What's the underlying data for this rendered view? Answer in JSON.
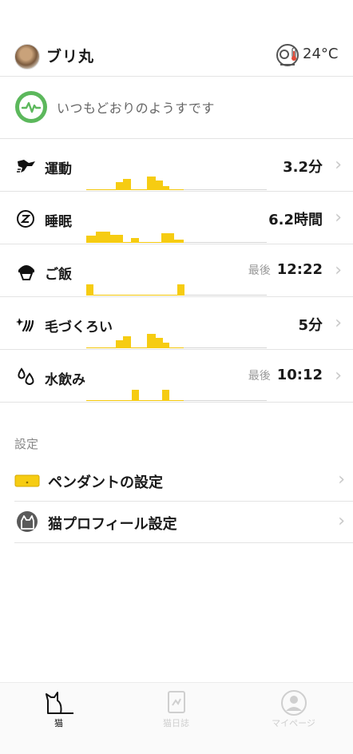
{
  "header": {
    "cat_name": "ブリ丸",
    "temperature": "24°C"
  },
  "status": {
    "message": "いつもどおりのようすです"
  },
  "metrics": [
    {
      "label": "運動",
      "prefix": "",
      "value": "3.2分",
      "icon": "running-cat-icon"
    },
    {
      "label": "睡眠",
      "prefix": "",
      "value": "6.2時間",
      "icon": "sleep-icon"
    },
    {
      "label": "ご飯",
      "prefix": "最後",
      "value": "12:22",
      "icon": "food-bowl-icon"
    },
    {
      "label": "毛づくろい",
      "prefix": "",
      "value": "5分",
      "icon": "grooming-icon"
    },
    {
      "label": "水飲み",
      "prefix": "最後",
      "value": "10:12",
      "icon": "water-drop-icon"
    }
  ],
  "settings": {
    "title": "設定",
    "items": [
      {
        "label": "ペンダントの設定",
        "icon": "pendant-icon"
      },
      {
        "label": "猫プロフィール設定",
        "icon": "cat-profile-icon"
      }
    ]
  },
  "tabbar": {
    "tabs": [
      {
        "label": "猫",
        "icon": "cat-icon",
        "active": true
      },
      {
        "label": "猫日誌",
        "icon": "diary-icon",
        "active": false
      },
      {
        "label": "マイページ",
        "icon": "user-icon",
        "active": false
      }
    ]
  },
  "colors": {
    "accent_yellow": "#f6cc12",
    "status_green": "#5cb85c",
    "divider": "#e3e3e3"
  }
}
